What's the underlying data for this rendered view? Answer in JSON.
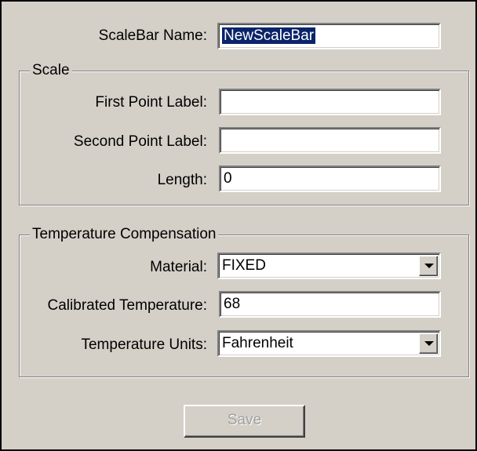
{
  "form": {
    "scalebar_name_label": "ScaleBar Name:",
    "scalebar_name_value": "NewScaleBar"
  },
  "scale_group": {
    "title": "Scale",
    "first_point_label": "First Point Label:",
    "first_point_value": "",
    "second_point_label": "Second Point Label:",
    "second_point_value": "",
    "length_label": "Length:",
    "length_value": "0"
  },
  "temp_group": {
    "title": "Temperature Compensation",
    "material_label": "Material:",
    "material_value": "FIXED",
    "calibrated_temp_label": "Calibrated Temperature:",
    "calibrated_temp_value": "68",
    "temp_units_label": "Temperature Units:",
    "temp_units_value": "Fahrenheit"
  },
  "actions": {
    "save_label": "Save"
  }
}
